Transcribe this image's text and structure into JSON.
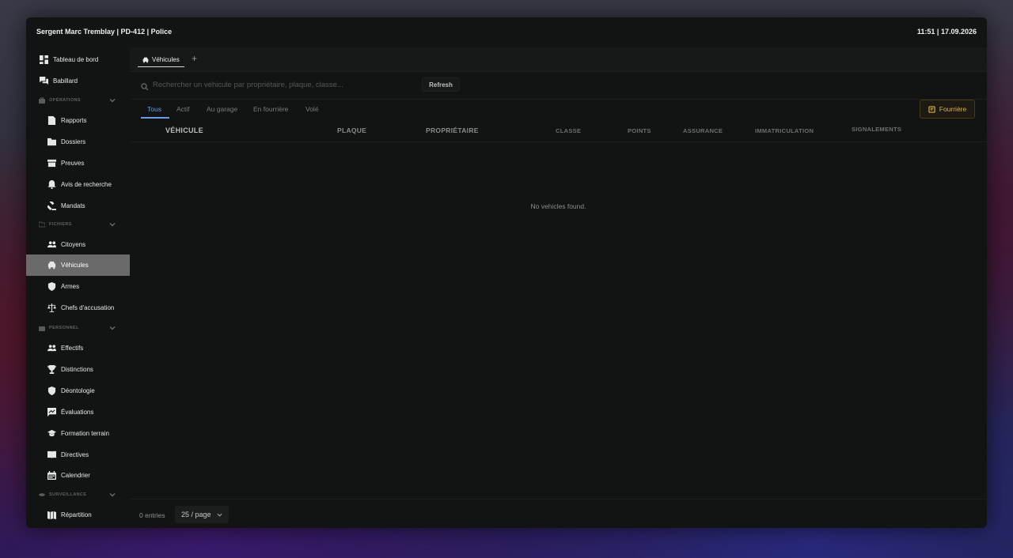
{
  "titlebar": {
    "user": "Sergent Marc Tremblay | PD-412 | Police",
    "datetime": "11:51 | 17.09.2026"
  },
  "sidebar": {
    "top_items": [
      {
        "label": "Tableau de bord",
        "icon": "dashboard-icon"
      },
      {
        "label": "Babillard",
        "icon": "forum-icon"
      }
    ],
    "sections": [
      {
        "title": "OPÉRATIONS",
        "items": [
          {
            "label": "Rapports",
            "icon": "file-icon"
          },
          {
            "label": "Dossiers",
            "icon": "folder-icon"
          },
          {
            "label": "Preuves",
            "icon": "archive-icon"
          },
          {
            "label": "Avis de recherche",
            "icon": "bell-icon"
          },
          {
            "label": "Mandats",
            "icon": "gavel-icon"
          }
        ]
      },
      {
        "title": "FICHIERS",
        "items": [
          {
            "label": "Citoyens",
            "icon": "people-icon"
          },
          {
            "label": "Véhicules",
            "icon": "car-icon",
            "active": true
          },
          {
            "label": "Armes",
            "icon": "shield-icon"
          },
          {
            "label": "Chefs d'accusation",
            "icon": "scale-icon"
          }
        ]
      },
      {
        "title": "PERSONNEL",
        "items": [
          {
            "label": "Effectifs",
            "icon": "people-icon"
          },
          {
            "label": "Distinctions",
            "icon": "trophy-icon"
          },
          {
            "label": "Déontologie",
            "icon": "shield-icon"
          },
          {
            "label": "Évaluations",
            "icon": "evaluation-icon"
          },
          {
            "label": "Formation terrain",
            "icon": "graduation-cap-icon"
          },
          {
            "label": "Directives",
            "icon": "book-icon"
          },
          {
            "label": "Calendrier",
            "icon": "calendar-icon"
          }
        ]
      },
      {
        "title": "SURVEILLANCE",
        "items": [
          {
            "label": "Répartition",
            "icon": "map-icon"
          }
        ]
      }
    ]
  },
  "tabs": {
    "current": "Véhicules",
    "add": "+"
  },
  "search": {
    "placeholder": "Rechercher un véhicule par propriétaire, plaque, classe...",
    "value": "",
    "refresh_label": "Refresh"
  },
  "filters": {
    "tabs": [
      "Tous",
      "Actif",
      "Au garage",
      "En fourrière",
      "Volé"
    ],
    "active": "Tous",
    "fourriere_label": "Fourrière"
  },
  "table": {
    "columns": [
      "VÉHICULE",
      "PLAQUE",
      "PROPRIÉTAIRE",
      "CLASSE",
      "POINTS",
      "ASSURANCE",
      "IMMATRICULATION",
      "SIGNALEMENTS"
    ],
    "rows": [],
    "empty_message": "No vehicles found."
  },
  "footer": {
    "entries": "0 entries",
    "page_size": "25 / page"
  },
  "colors": {
    "accent_blue": "#6b9de0",
    "accent_gold": "#e0b043",
    "active_nav_bg": "#6a6a6a"
  }
}
